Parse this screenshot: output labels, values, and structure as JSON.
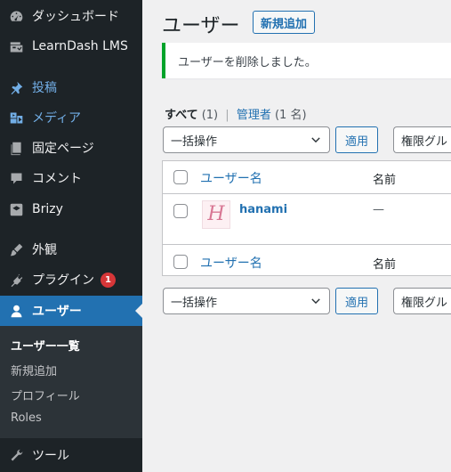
{
  "sidebar": {
    "items": [
      {
        "label": "ダッシュボード",
        "icon": "dashboard-icon"
      },
      {
        "label": "LearnDash LMS",
        "icon": "learndash-icon"
      },
      {
        "label": "投稿",
        "icon": "pin-icon"
      },
      {
        "label": "メディア",
        "icon": "media-icon"
      },
      {
        "label": "固定ページ",
        "icon": "page-icon"
      },
      {
        "label": "コメント",
        "icon": "comment-icon"
      },
      {
        "label": "Brizy",
        "icon": "brizy-icon"
      },
      {
        "label": "外観",
        "icon": "appearance-icon"
      },
      {
        "label": "プラグイン",
        "icon": "plugin-icon",
        "badge": "1"
      },
      {
        "label": "ユーザー",
        "icon": "user-icon"
      },
      {
        "label": "ツール",
        "icon": "tools-icon"
      }
    ],
    "submenu": [
      "ユーザー一覧",
      "新規追加",
      "プロフィール",
      "Roles"
    ]
  },
  "main": {
    "title": "ユーザー",
    "add_new": "新規追加",
    "notice": "ユーザーを削除しました。",
    "views": {
      "all": "すべて",
      "all_count": "(1)",
      "sep": "|",
      "admin": "管理者",
      "admin_count": "(1 名)"
    },
    "bulk_label": "一括操作",
    "apply": "適用",
    "role_label": "権限グル",
    "table": {
      "header_username": "ユーザー名",
      "header_name": "名前",
      "rows": [
        {
          "username": "hanami",
          "name": "—",
          "avatar_letter": "H"
        }
      ]
    }
  },
  "colors": {
    "sidebar_bg": "#1d2327",
    "accent": "#2271b1",
    "notice_border": "#00a32a",
    "badge": "#d63638"
  }
}
